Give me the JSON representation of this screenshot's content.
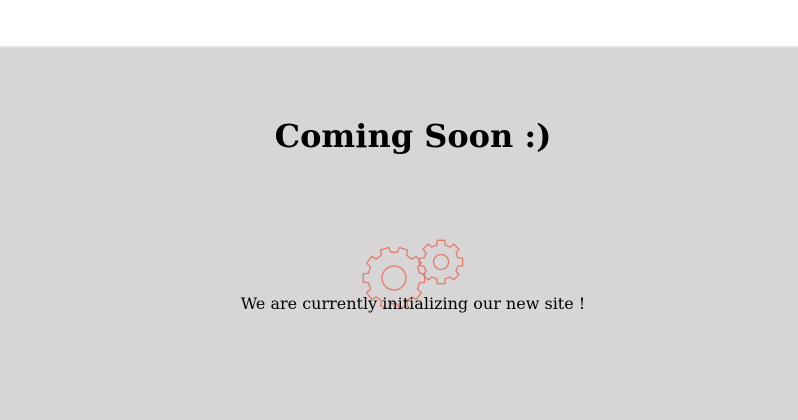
{
  "page": {
    "title": "Coming Soon :)",
    "message": "We are currently initializing our new site !"
  },
  "icons": {
    "gears": "gears-icon"
  },
  "colors": {
    "header_background": "#ffffff",
    "content_background": "#d8d5d6",
    "gear_stroke": "#e07b6e",
    "text": "#000000"
  }
}
